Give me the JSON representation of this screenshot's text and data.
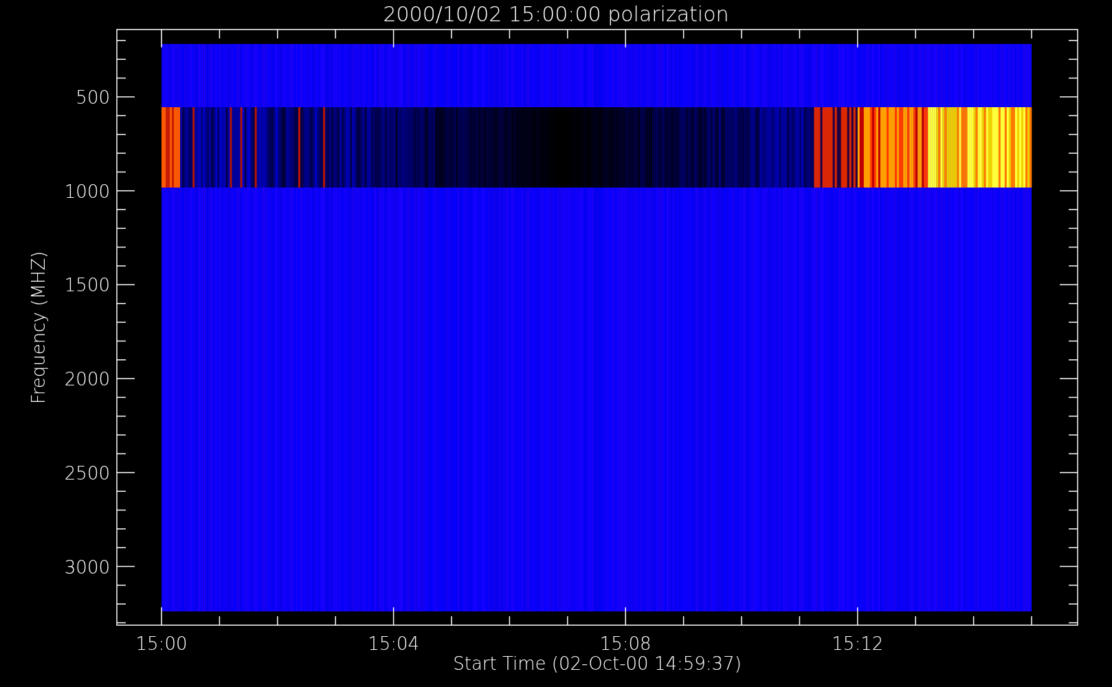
{
  "title": "2000/10/02 15:00:00 polarization",
  "y_axis": {
    "label": "Frequency (MHZ)",
    "ticks": [
      "500",
      "1000",
      "1500",
      "2000",
      "2500",
      "3000"
    ]
  },
  "x_axis": {
    "label": "Start Time (02-Oct-00 14:59:37)",
    "ticks": [
      "15:00",
      "15:04",
      "15:08",
      "15:12"
    ]
  }
}
